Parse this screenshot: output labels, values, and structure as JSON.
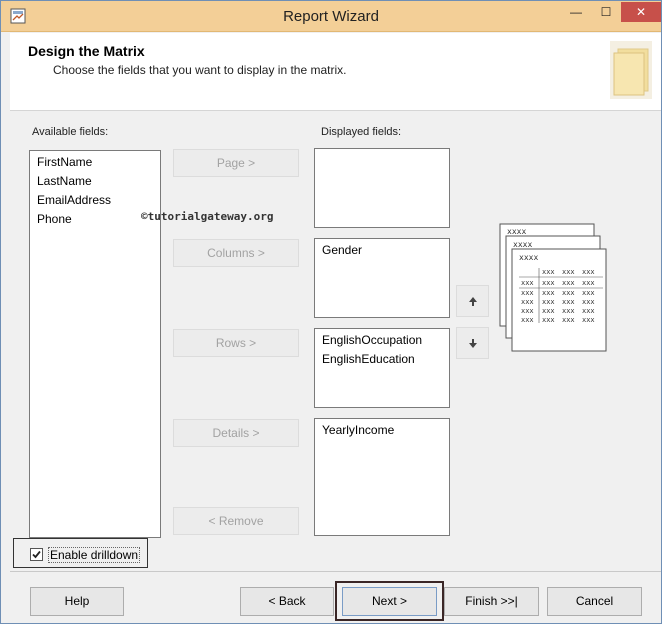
{
  "window": {
    "title": "Report Wizard",
    "minimize_glyph": "—",
    "maximize_glyph": "☐",
    "close_glyph": "✕"
  },
  "header": {
    "title": "Design the Matrix",
    "subtitle": "Choose the fields that you want to display in the matrix."
  },
  "available": {
    "label": "Available fields:",
    "items": [
      "FirstName",
      "LastName",
      "EmailAddress",
      "Phone"
    ]
  },
  "watermark": "©tutorialgateway.org",
  "move_buttons": {
    "page": "Page >",
    "columns": "Columns >",
    "rows": "Rows >",
    "details": "Details >",
    "remove": "< Remove"
  },
  "displayed": {
    "label": "Displayed fields:",
    "page_items": [],
    "columns_items": [
      "Gender"
    ],
    "rows_items": [
      "EnglishOccupation",
      "EnglishEducation"
    ],
    "details_items": [
      "YearlyIncome"
    ]
  },
  "matrix_preview": {
    "cell_text": "xxxx",
    "grid_text": "xxx"
  },
  "drilldown": {
    "label": "Enable drilldown",
    "checked": true
  },
  "footer": {
    "help": "Help",
    "back": "< Back",
    "next": "Next >",
    "finish": "Finish >>|",
    "cancel": "Cancel"
  },
  "colors": {
    "titlebar": "#f3cf97",
    "close_button": "#c7504a",
    "highlight_frame": "#3a2626"
  }
}
